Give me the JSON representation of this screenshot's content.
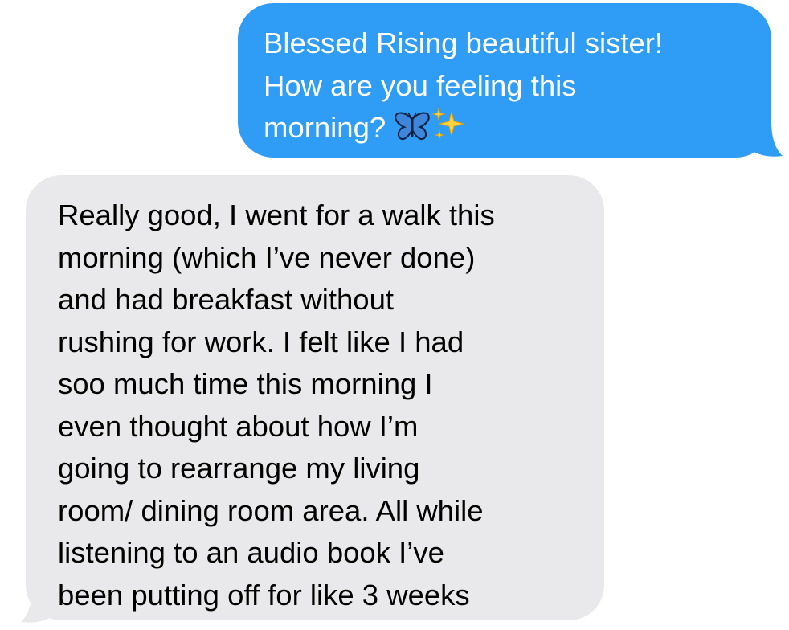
{
  "colors": {
    "sent_bubble": "#2f9cf5",
    "received_bubble": "#e9e9eb",
    "sent_text": "#ffffff",
    "received_text": "#000000"
  },
  "messages": [
    {
      "direction": "sent",
      "lines": [
        "Blessed Rising beautiful sister!",
        "How are you feeling this",
        "morning?"
      ],
      "emojis": [
        "butterfly-icon",
        "sparkles-icon"
      ]
    },
    {
      "direction": "received",
      "lines": [
        "Really good, I went for a walk this",
        "morning (which I’ve never done)",
        "and had breakfast without",
        "rushing for work. I felt like I had",
        "soo much time this morning I",
        "even thought about how I’m",
        "going to rearrange my living",
        "room/ dining room area. All while",
        "listening to an audio book I’ve",
        "been putting off for like 3 weeks"
      ]
    }
  ]
}
